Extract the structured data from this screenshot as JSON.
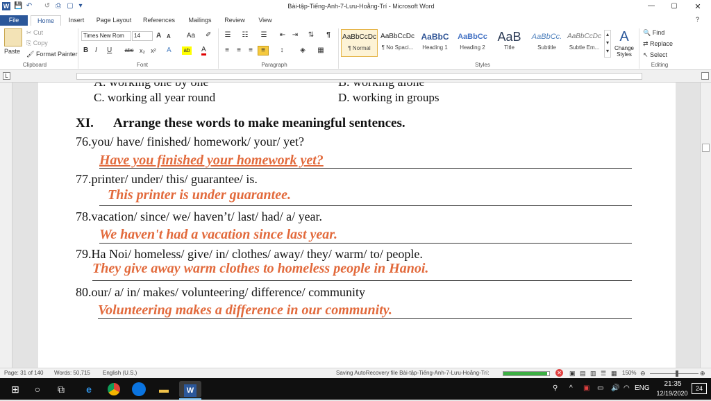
{
  "window": {
    "title": "Bài-tập-Tiếng-Anh-7-Lưu-Hoằng-Trí - Microsoft Word",
    "minimize": "—",
    "maximize": "▢",
    "close": "✕",
    "help": "?"
  },
  "quick_access": {
    "word_icon": "W",
    "save": "💾",
    "undo": "↶",
    "redo": "↺",
    "print": "⎙",
    "new": "▢",
    "more": "▾"
  },
  "tabs": [
    "File",
    "Home",
    "Insert",
    "Page Layout",
    "References",
    "Mailings",
    "Review",
    "View"
  ],
  "ribbon": {
    "clipboard": {
      "paste": "Paste",
      "cut": "Cut",
      "copy": "Copy",
      "format_painter": "Format Painter",
      "label": "Clipboard"
    },
    "font": {
      "font_name": "Times New Rom",
      "font_size": "14",
      "label": "Font",
      "bold": "B",
      "italic": "I",
      "underline": "U",
      "strike": "abc",
      "subscript": "x₂",
      "superscript": "x²",
      "grow": "A",
      "shrink": "A",
      "case": "Aa",
      "clear": "✐",
      "effects": "A",
      "highlight": "ab",
      "color": "A"
    },
    "paragraph": {
      "label": "Paragraph",
      "pilcrow": "¶"
    },
    "styles": {
      "label": "Styles",
      "items": [
        {
          "sample": "AaBbCcDc",
          "name": "¶ Normal"
        },
        {
          "sample": "AaBbCcDc",
          "name": "¶ No Spaci..."
        },
        {
          "sample": "AaBbC",
          "name": "Heading 1"
        },
        {
          "sample": "AaBbCc",
          "name": "Heading 2"
        },
        {
          "sample": "AaB",
          "name": "Title"
        },
        {
          "sample": "AaBbCc.",
          "name": "Subtitle"
        },
        {
          "sample": "AaBbCcDc",
          "name": "Subtle Em..."
        }
      ],
      "change_styles": "Change Styles"
    },
    "editing": {
      "label": "Editing",
      "find": "Find",
      "replace": "Replace",
      "select": "Select"
    }
  },
  "document": {
    "cut_top_a": "A. working one by one",
    "cut_top_b": "B. working alone",
    "line_c": "C. working all year round",
    "line_d": "D. working in groups",
    "section_number": "XI.",
    "section_title": "Arrange these words to make meaningful sentences.",
    "exercises": [
      {
        "prompt": "76.you/ have/ finished/ homework/ your/ yet?",
        "answer": "Have you finished your homework yet?"
      },
      {
        "prompt": "77.printer/ under/ this/ guarantee/ is.",
        "answer": "This printer is under guarantee."
      },
      {
        "prompt": "78.vacation/ since/ we/ haven’t/ last/ had/ a/ year.",
        "answer": "We haven't had a vacation since last year."
      },
      {
        "prompt": "79.Ha Noi/ homeless/ give/ in/ clothes/ away/ they/ warm/ to/ people.",
        "answer": "They give away warm clothes to homeless people in Hanoi."
      },
      {
        "prompt": "80.our/ a/ in/ makes/ volunteering/ difference/ community",
        "answer": "Volunteering makes a difference in our community."
      }
    ]
  },
  "statusbar": {
    "page": "Page: 31 of 140",
    "words": "Words: 50,715",
    "language": "English (U.S.)",
    "autosave": "Saving AutoRecovery file Bài-tập-Tiếng-Anh-7-Lưu-Hoằng-Trí:",
    "autosave_progress": 0.95,
    "zoom": "150%"
  },
  "taskbar": {
    "language": "ENG",
    "time": "21:35",
    "date": "12/19/2020",
    "notifications": "24"
  },
  "colors": {
    "accent": "#2b579a",
    "answer": "#e26a3c",
    "taskbar": "#101010"
  }
}
